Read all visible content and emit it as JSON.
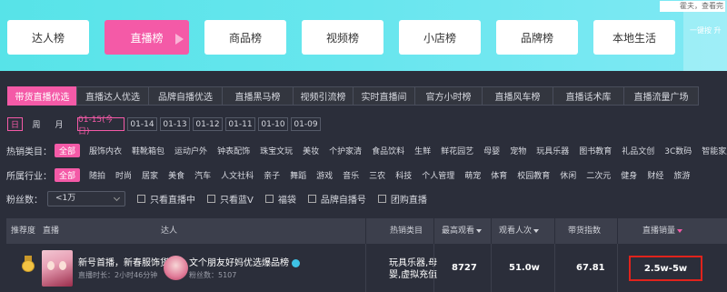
{
  "top_tabs": [
    "达人榜",
    "直播榜",
    "商品榜",
    "视频榜",
    "小店榜",
    "品牌榜",
    "本地生活"
  ],
  "corner": {
    "text": "霍夫，查看完",
    "side": "一键按\n升"
  },
  "sub_tabs": [
    "带货直播优选",
    "直播达人优选",
    "品牌自播优选",
    "直播黑马榜",
    "视频引流榜",
    "实时直播间",
    "官方小时榜",
    "直播风车榜",
    "直播话术库",
    "直播流量广场"
  ],
  "date_row": {
    "periods": [
      "日",
      "周",
      "月"
    ],
    "dates": [
      "01-15(今日)",
      "01-14",
      "01-13",
      "01-12",
      "01-11",
      "01-10",
      "01-09"
    ]
  },
  "hot_categories": {
    "label": "热销类目：",
    "items": [
      "全部",
      "服饰内衣",
      "鞋靴箱包",
      "运动户外",
      "钟表配饰",
      "珠宝文玩",
      "美妆",
      "个护家清",
      "食品饮料",
      "生鲜",
      "鲜花园艺",
      "母婴",
      "宠物",
      "玩具乐器",
      "图书教育",
      "礼品文创",
      "3C数码",
      "智能家居"
    ]
  },
  "industries": {
    "label": "所属行业：",
    "items": [
      "全部",
      "随拍",
      "时尚",
      "居家",
      "美食",
      "汽车",
      "人文社科",
      "亲子",
      "舞蹈",
      "游戏",
      "音乐",
      "三农",
      "科技",
      "个人管理",
      "萌宠",
      "体育",
      "校园教育",
      "休闲",
      "二次元",
      "健身",
      "财经",
      "旅游"
    ]
  },
  "fans_filter": {
    "label": "粉丝数：",
    "select_value": "<1万",
    "checkboxes": [
      "只看直播中",
      "只看蓝V",
      "福袋",
      "品牌自播号",
      "团购直播"
    ]
  },
  "table": {
    "headers": {
      "rank": "推荐度",
      "live": "直播",
      "author": "达人",
      "category": "热销类目",
      "peak": "最高观看",
      "viewers": "观看人次",
      "index": "带货指数",
      "sales": "直播销量"
    },
    "row": {
      "room_title": "新号首播，新春服饰货...",
      "room_meta": "直播时长：2小时46分钟",
      "author_name": "文个朋友好妈优选爆品榜",
      "fans": "粉丝数：5107",
      "category": "玩具乐器,母婴,虚拟充值",
      "peak": "8727",
      "viewers": "51.0w",
      "index": "67.81",
      "sales": "2.5w-5w"
    }
  },
  "colors": {
    "accent": "#f45aa7",
    "banner": "#62e4ec",
    "highlight_box": "#e0231c"
  }
}
